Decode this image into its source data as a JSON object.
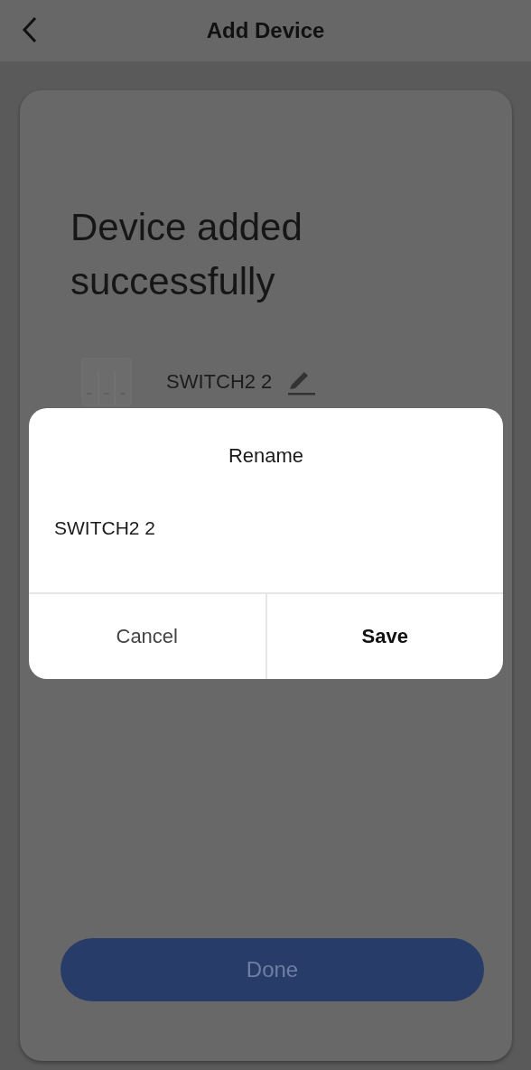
{
  "header": {
    "title": "Add Device"
  },
  "result": {
    "heading": "Device added successfully",
    "device_name": "SWITCH2 2"
  },
  "done_button": {
    "label": "Done",
    "disabled": true
  },
  "rename_dialog": {
    "title": "Rename",
    "value": "SWITCH2 2",
    "buttons": [
      {
        "label": "Cancel",
        "kind": "secondary"
      },
      {
        "label": "Save",
        "kind": "primary"
      }
    ]
  }
}
